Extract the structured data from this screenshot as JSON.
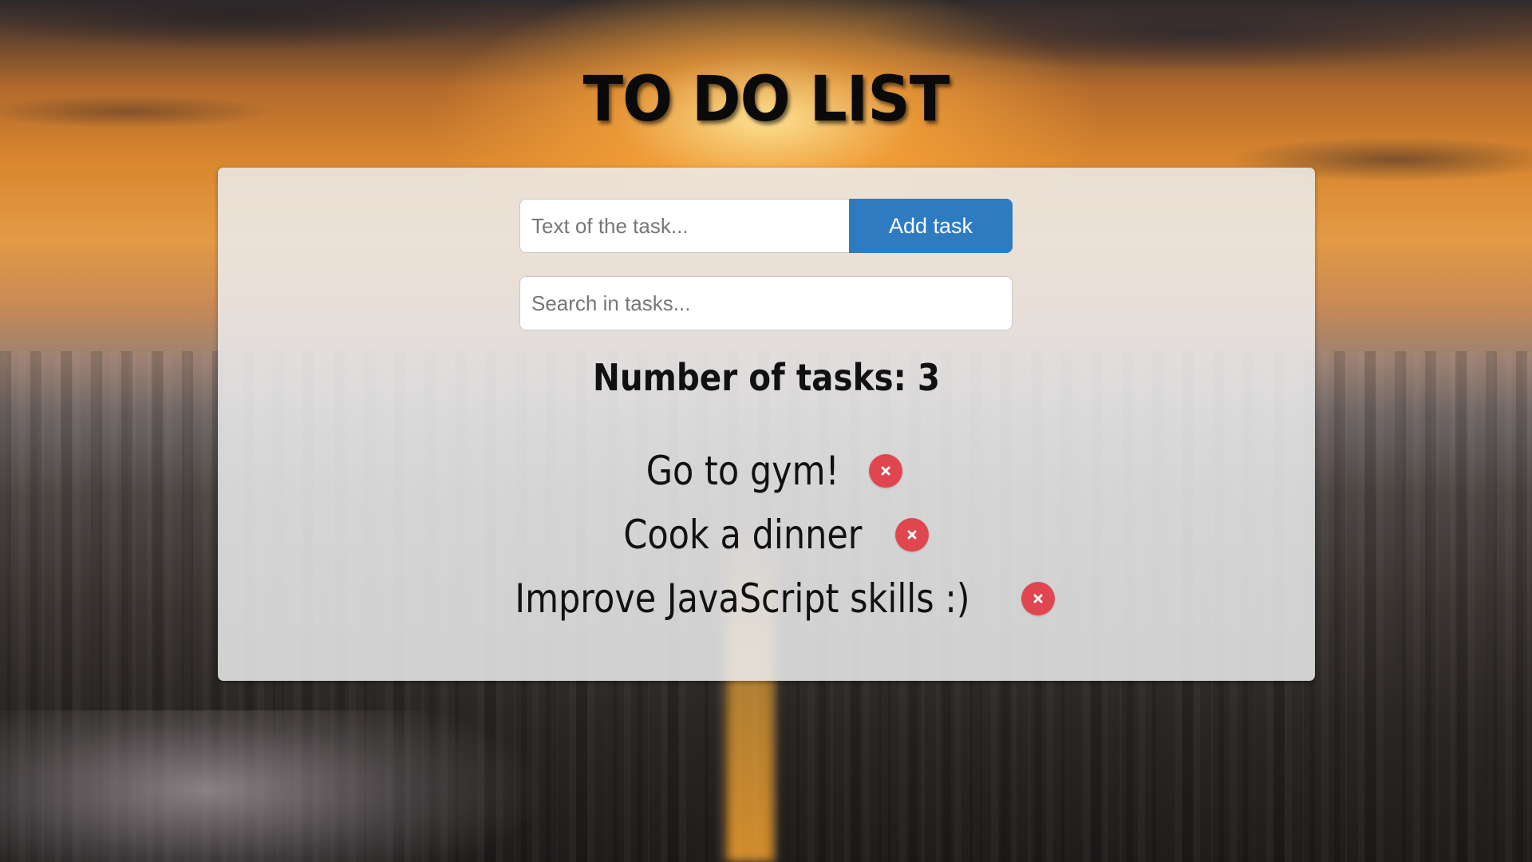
{
  "header": {
    "title": "TO DO LIST"
  },
  "form": {
    "task_placeholder": "Text of the task...",
    "add_button_label": "Add task",
    "search_placeholder": "Search in tasks..."
  },
  "counter": {
    "text": "Number of tasks: 3"
  },
  "tasks": [
    {
      "text": "Go to gym!",
      "icon": "close-icon"
    },
    {
      "text": "Cook a dinner",
      "icon": "close-icon"
    },
    {
      "text": "Improve JavaScript skills :)",
      "icon": "close-icon"
    }
  ],
  "colors": {
    "accent": "#2f7bc1",
    "delete": "#e0464f",
    "panel": "#ececee"
  }
}
